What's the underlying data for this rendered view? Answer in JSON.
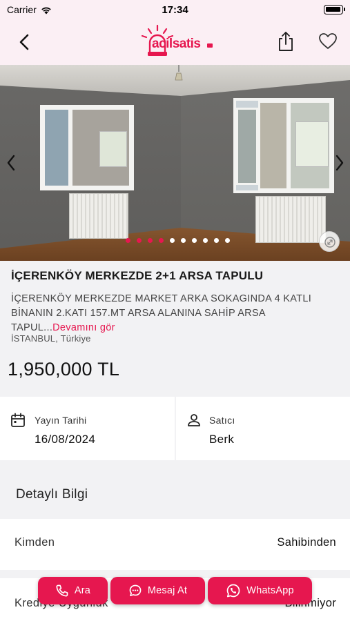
{
  "status_bar": {
    "carrier": "Carrier",
    "time": "17:34"
  },
  "nav": {
    "logo_text": "acilsatis",
    "icons": [
      "back-chevron-icon",
      "share-icon",
      "heart-icon"
    ],
    "accent_color": "#e6174f"
  },
  "gallery": {
    "photo_count": 10,
    "active_dots": 4
  },
  "listing": {
    "title": "İÇERENKÖY MERKEZDE 2+1 ARSA TAPULU",
    "description": "İÇERENKÖY MERKEZDE MARKET ARKA SOKAGINDA 4 KATLI BİNANIN 2.KATI 157.MT ARSA ALANINA SAHİP ARSA TAPUL...",
    "read_more": "Devamını gör",
    "location": "İSTANBUL, Türkiye",
    "price": "1,950,000 TL"
  },
  "cards": {
    "date_label": "Yayın Tarihi",
    "date_value": "16/08/2024",
    "seller_label": "Satıcı",
    "seller_value": "Berk"
  },
  "details": {
    "header": "Detaylı Bilgi",
    "rows": [
      {
        "label": "Kimden",
        "value": "Sahibinden"
      },
      {
        "label": "Krediye Uygunluk",
        "value": "Bilinmiyor"
      }
    ]
  },
  "actions": {
    "call": "Ara",
    "message": "Mesaj At",
    "whatsapp": "WhatsApp"
  }
}
